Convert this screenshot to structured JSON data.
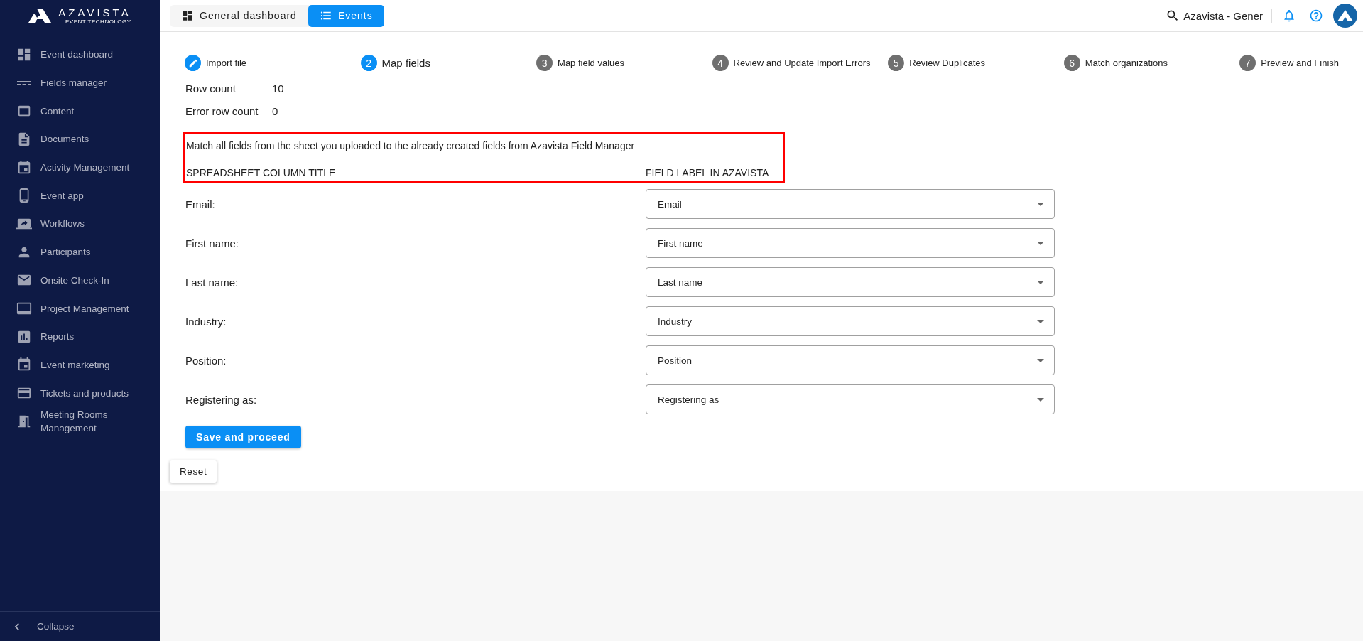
{
  "sidebar": {
    "logo": {
      "name": "AZAVISTA",
      "tagline": "EVENT TECHNOLOGY"
    },
    "items": [
      {
        "label": "Event dashboard"
      },
      {
        "label": "Fields manager"
      },
      {
        "label": "Content"
      },
      {
        "label": "Documents"
      },
      {
        "label": "Activity Management"
      },
      {
        "label": "Event app"
      },
      {
        "label": "Workflows"
      },
      {
        "label": "Participants"
      },
      {
        "label": "Onsite Check-In"
      },
      {
        "label": "Project Management"
      },
      {
        "label": "Reports"
      },
      {
        "label": "Event marketing"
      },
      {
        "label": "Tickets and products"
      },
      {
        "label": "Meeting Rooms Management"
      }
    ],
    "collapse": "Collapse"
  },
  "header": {
    "tabs": [
      {
        "label": "General dashboard",
        "selected": false
      },
      {
        "label": "Events",
        "selected": true
      }
    ],
    "search_value": "Azavista - Gener"
  },
  "stepper": [
    {
      "label": "Import file",
      "completed": true,
      "selected": false
    },
    {
      "number": "2",
      "label": "Map fields",
      "completed": false,
      "selected": true
    },
    {
      "number": "3",
      "label": "Map field values",
      "completed": false,
      "selected": false
    },
    {
      "number": "4",
      "label": "Review and Update Import Errors",
      "completed": false,
      "selected": false
    },
    {
      "number": "5",
      "label": "Review Duplicates",
      "completed": false,
      "selected": false
    },
    {
      "number": "6",
      "label": "Match organizations",
      "completed": false,
      "selected": false
    },
    {
      "number": "7",
      "label": "Preview and Finish",
      "completed": false,
      "selected": false
    }
  ],
  "stats": [
    {
      "label": "Row count",
      "value": "10"
    },
    {
      "label": "Error row count",
      "value": "0"
    }
  ],
  "instruction": "Match all fields from the sheet you uploaded to the already created fields from Azavista Field Manager",
  "columns": [
    "SPREADSHEET COLUMN TITLE",
    "FIELD LABEL IN AZAVISTA"
  ],
  "mappings": [
    {
      "column": "Email:",
      "field": "Email"
    },
    {
      "column": "First name:",
      "field": "First name"
    },
    {
      "column": "Last name:",
      "field": "Last name"
    },
    {
      "column": "Industry:",
      "field": "Industry"
    },
    {
      "column": "Position:",
      "field": "Position"
    },
    {
      "column": "Registering as:",
      "field": "Registering as"
    }
  ],
  "buttons": {
    "save": "Save and proceed",
    "reset": "Reset"
  }
}
